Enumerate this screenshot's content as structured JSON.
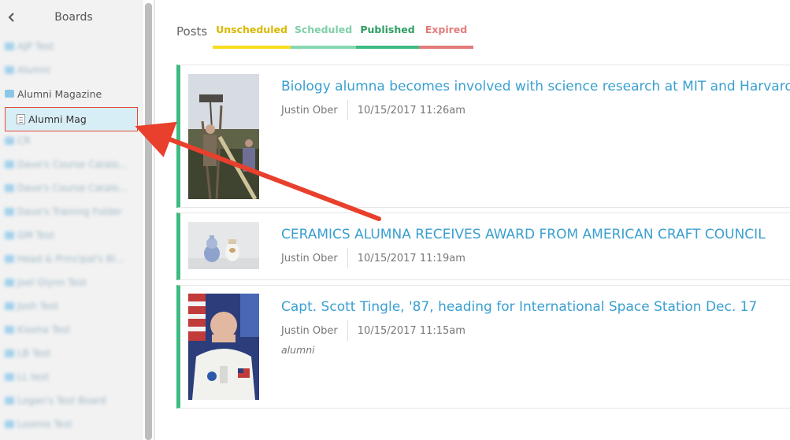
{
  "sidebar": {
    "title": "Boards",
    "boards": [
      {
        "label": "AJP Test"
      },
      {
        "label": "Alumni"
      },
      {
        "label": "Alumni Magazine"
      },
      {
        "label": "Alumni Mag"
      },
      {
        "label": "CR"
      },
      {
        "label": "Dave's Course Catalo..."
      },
      {
        "label": "Dave's Course Catalo..."
      },
      {
        "label": "Dave's Training Folder"
      },
      {
        "label": "GM Test"
      },
      {
        "label": "Head & Principal's Bl..."
      },
      {
        "label": "Joel Glynn Test"
      },
      {
        "label": "Josh Test"
      },
      {
        "label": "Kiosha Test"
      },
      {
        "label": "LB Test"
      },
      {
        "label": "LL test"
      },
      {
        "label": "Logan's Test Board"
      },
      {
        "label": "Loomis Test"
      }
    ]
  },
  "main": {
    "posts_label": "Posts",
    "tabs": [
      {
        "label": "Unscheduled",
        "color": "#d9b800",
        "underline": "#f7dd1c"
      },
      {
        "label": "Scheduled",
        "color": "#7fcfa8",
        "underline": "#86d6b2"
      },
      {
        "label": "Published",
        "color": "#2f9e63",
        "underline": "#3dbb83"
      },
      {
        "label": "Expired",
        "color": "#e47b7b",
        "underline": "#e47b7b"
      }
    ],
    "posts": [
      {
        "title": "Biology alumna becomes involved with science research at MIT and Harvard",
        "author": "Justin Ober",
        "datetime": "10/15/2017 11:26am",
        "tag": ""
      },
      {
        "title": "CERAMICS ALUMNA RECEIVES AWARD FROM AMERICAN CRAFT COUNCIL",
        "author": "Justin Ober",
        "datetime": "10/15/2017 11:19am",
        "tag": ""
      },
      {
        "title": "Capt. Scott Tingle, '87, heading for International Space Station Dec. 17",
        "author": "Justin Ober",
        "datetime": "10/15/2017 11:15am",
        "tag": "alumni"
      }
    ]
  },
  "colors": {
    "published_border": "#3dbb83",
    "link": "#3a9fd0",
    "highlight_box": "#e24a38",
    "arrow": "#e8402c"
  }
}
